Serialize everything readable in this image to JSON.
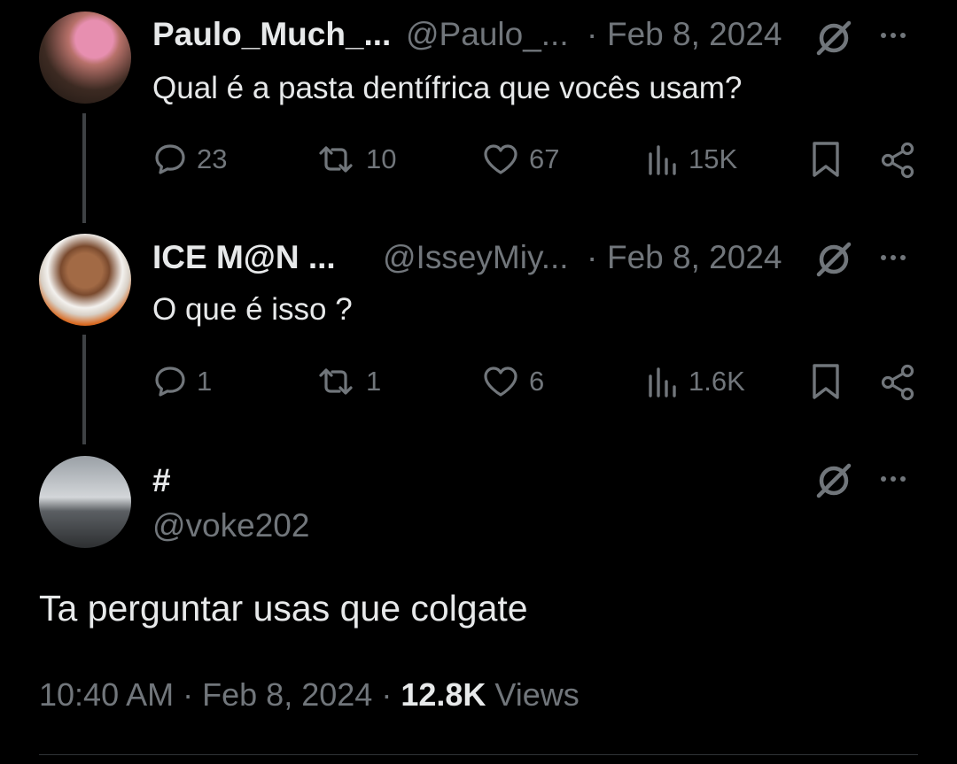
{
  "replies": [
    {
      "display_name": "Paulo_Much_...",
      "handle": "@Paulo_...",
      "sep": "·",
      "date": "Feb 8, 2024",
      "text": "Qual é a pasta dentífrica que vocês usam?",
      "stats": {
        "replies": "23",
        "reposts": "10",
        "likes": "67",
        "views": "15K"
      }
    },
    {
      "display_name": "ICE M@N ...",
      "handle": "@IsseyMiy...",
      "sep": "·",
      "date": "Feb 8, 2024",
      "text": "O que é isso ?",
      "stats": {
        "replies": "1",
        "reposts": "1",
        "likes": "6",
        "views": "1.6K"
      }
    }
  ],
  "main_post": {
    "display_name": "#",
    "handle": "@voke202",
    "text": "Ta perguntar usas que colgate",
    "time": "10:40 AM",
    "sep1": "·",
    "date": "Feb 8, 2024",
    "sep2": "·",
    "views_count": "12.8K",
    "views_label": "Views"
  },
  "icons": {
    "reply": "speech-bubble-icon",
    "repost": "repost-arrows-icon",
    "like": "heart-icon",
    "views": "bar-chart-icon",
    "bookmark": "bookmark-icon",
    "share": "share-icon",
    "grok": "grok-slash-circle-icon",
    "more": "ellipsis-icon"
  },
  "colors": {
    "background": "#000000",
    "primary_text": "#e7e9ea",
    "secondary_text": "#71767b",
    "thread_line": "#3e4144"
  }
}
